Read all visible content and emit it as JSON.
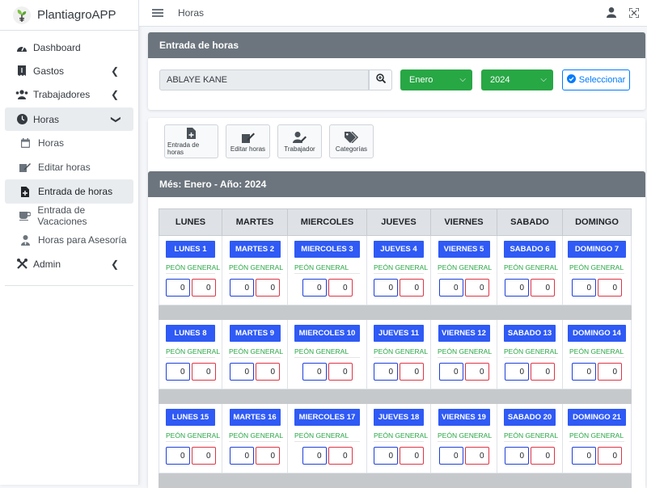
{
  "app": {
    "name": "PlantiagroAPP"
  },
  "topbar": {
    "title": "Horas"
  },
  "sidebar": {
    "items": [
      {
        "label": "Dashboard",
        "icon": "tachometer-icon"
      },
      {
        "label": "Gastos",
        "icon": "receipt-icon"
      },
      {
        "label": "Trabajadores",
        "icon": "users-icon"
      },
      {
        "label": "Horas",
        "icon": "clock-icon"
      },
      {
        "label": "Admin",
        "icon": "tools-icon"
      }
    ],
    "sub_items": [
      {
        "label": "Horas",
        "icon": "calendar-icon"
      },
      {
        "label": "Editar horas",
        "icon": "edit-icon"
      },
      {
        "label": "Entrada de horas",
        "icon": "file-plus-icon"
      },
      {
        "label": "Entrada de Vacaciones",
        "icon": "coffee-icon"
      },
      {
        "label": "Horas para Asesoría",
        "icon": "user-tie-icon"
      }
    ]
  },
  "entry": {
    "header": "Entrada de horas",
    "employee": "ABLAYE KANE",
    "month": "Enero",
    "year": "2024",
    "select_button": "Seleccionar"
  },
  "tools": [
    {
      "label": "Entrada de horas",
      "icon": "file-plus-icon"
    },
    {
      "label": "Editar horas",
      "icon": "edit-icon"
    },
    {
      "label": "Trabajador",
      "icon": "user-edit-icon"
    },
    {
      "label": "Categorías",
      "icon": "tags-icon"
    }
  ],
  "calendar": {
    "header": "Més: Enero - Año: 2024",
    "weekdays": [
      "LUNES",
      "MARTES",
      "MIERCOLES",
      "JUEVES",
      "VIERNES",
      "SABADO",
      "DOMINGO"
    ],
    "category": "PEÓN GENERAL",
    "weeks": [
      [
        {
          "label": "LUNES 1",
          "in": "0",
          "out": "0"
        },
        {
          "label": "MARTES 2",
          "in": "0",
          "out": "0"
        },
        {
          "label": "MIERCOLES 3",
          "in": "0",
          "out": "0"
        },
        {
          "label": "JUEVES 4",
          "in": "0",
          "out": "0"
        },
        {
          "label": "VIERNES 5",
          "in": "0",
          "out": "0"
        },
        {
          "label": "SABADO 6",
          "in": "0",
          "out": "0"
        },
        {
          "label": "DOMINGO 7",
          "in": "0",
          "out": "0"
        }
      ],
      [
        {
          "label": "LUNES 8",
          "in": "0",
          "out": "0"
        },
        {
          "label": "MARTES 9",
          "in": "0",
          "out": "0"
        },
        {
          "label": "MIERCOLES 10",
          "in": "0",
          "out": "0"
        },
        {
          "label": "JUEVES 11",
          "in": "0",
          "out": "0"
        },
        {
          "label": "VIERNES 12",
          "in": "0",
          "out": "0"
        },
        {
          "label": "SABADO 13",
          "in": "0",
          "out": "0"
        },
        {
          "label": "DOMINGO 14",
          "in": "0",
          "out": "0"
        }
      ],
      [
        {
          "label": "LUNES 15",
          "in": "0",
          "out": "0"
        },
        {
          "label": "MARTES 16",
          "in": "0",
          "out": "0"
        },
        {
          "label": "MIERCOLES 17",
          "in": "0",
          "out": "0"
        },
        {
          "label": "JUEVES 18",
          "in": "0",
          "out": "0"
        },
        {
          "label": "VIERNES 19",
          "in": "0",
          "out": "0"
        },
        {
          "label": "SABADO 20",
          "in": "0",
          "out": "0"
        },
        {
          "label": "DOMINGO 21",
          "in": "0",
          "out": "0"
        }
      ]
    ]
  },
  "colors": {
    "primary": "#2f5af5",
    "success": "#28a745",
    "danger": "#dc3545",
    "header": "#6c757d"
  }
}
